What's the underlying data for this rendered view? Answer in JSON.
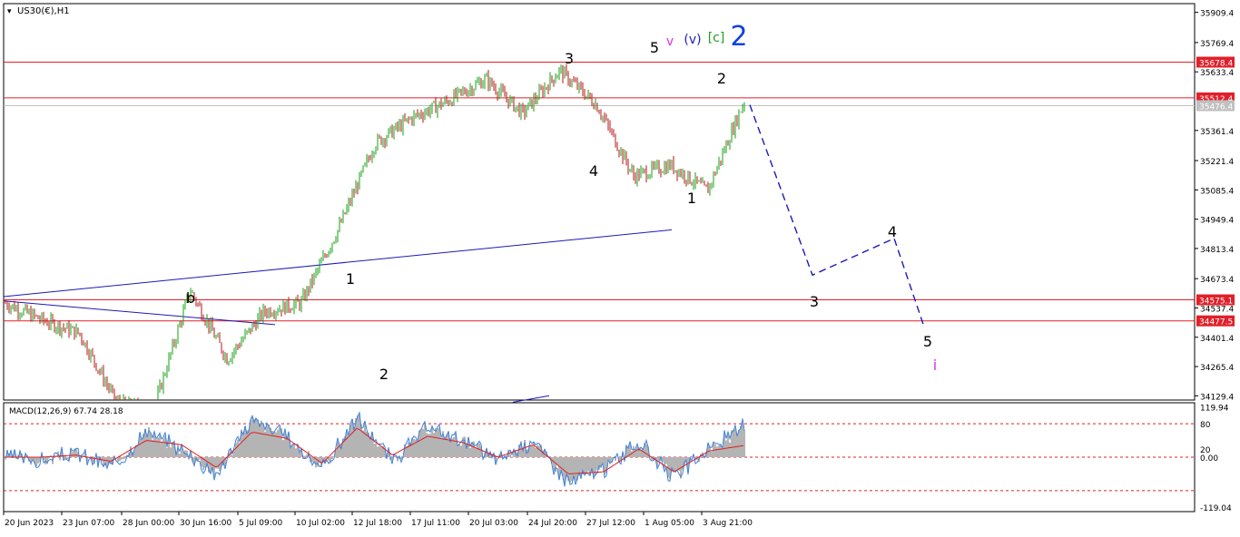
{
  "chart_data": [
    {
      "type": "candlestick",
      "title": "US30(€),H1",
      "y_ticks": [
        35909.4,
        35769.4,
        35633.4,
        35361.4,
        35221.4,
        35085.4,
        34949.4,
        34813.4,
        34673.4,
        34537.4,
        34401.4,
        34265.4,
        34129.4
      ],
      "ylim": [
        34110,
        35950
      ],
      "price_levels": [
        {
          "label": "35678.4",
          "color": "#e0202a"
        },
        {
          "label": "35512.4",
          "color": "#e0202a"
        },
        {
          "label": "35476.4",
          "color": "#c0c0c0"
        },
        {
          "label": "34575.1",
          "color": "#e0202a"
        },
        {
          "label": "34477.5",
          "color": "#e0202a"
        }
      ],
      "wave_labels": [
        {
          "text": "b",
          "color": "#000000",
          "value": 34620,
          "date_index": 3
        },
        {
          "text": "1",
          "color": "#000000",
          "value": 34700,
          "date_index": 6
        },
        {
          "text": "2",
          "color": "#000000",
          "value": 34230,
          "date_index": 6
        },
        {
          "text": "3",
          "color": "#000000",
          "value": 35640,
          "date_index": 10
        },
        {
          "text": "4",
          "color": "#000000",
          "value": 35190,
          "date_index": 10
        },
        {
          "text": "5",
          "color": "#000000",
          "value": 35720,
          "date_index": 11
        },
        {
          "text": "v",
          "color": "#e030e0",
          "value": 35740,
          "date_index": 11
        },
        {
          "text": "(v)",
          "color": "#2020c0",
          "value": 35740,
          "date_index": 11
        },
        {
          "text": "[c]",
          "color": "#20a020",
          "value": 35740,
          "date_index": 12
        },
        {
          "text": "2",
          "color": "#1040e0",
          "value": 35740,
          "date_index": 12
        },
        {
          "text": "1",
          "color": "#000000",
          "value": 35050,
          "date_index": 12
        },
        {
          "text": "2",
          "color": "#000000",
          "value": 35580,
          "date_index": 12
        },
        {
          "text": "3",
          "color": "#000000",
          "value": 34550,
          "date_index": 14
        },
        {
          "text": "4",
          "color": "#000000",
          "value": 34880,
          "date_index": 15
        },
        {
          "text": "5",
          "color": "#000000",
          "value": 34400,
          "date_index": 16
        },
        {
          "text": "i",
          "color": "#e030e0",
          "value": 34300,
          "date_index": 16
        }
      ],
      "projection": {
        "style": "dashed",
        "color": "#1a1ab8",
        "points": [
          {
            "date_index": 13,
            "value": 35480
          },
          {
            "date_index": 14,
            "value": 34690
          },
          {
            "date_index": 15,
            "value": 34860
          },
          {
            "date_index": 16,
            "value": 34450
          }
        ]
      },
      "x_ticks": [
        "20 Jun 2023",
        "23 Jun 07:00",
        "28 Jun 00:00",
        "30 Jun 16:00",
        "5 Jul 09:00",
        "10 Jul 02:00",
        "12 Jul 18:00",
        "17 Jul 11:00",
        "20 Jul 03:00",
        "24 Jul 20:00",
        "27 Jul 12:00",
        "1 Aug 05:00",
        "3 Aug 21:00"
      ],
      "series": [
        {
          "role": "price",
          "values": [
            34560,
            34480,
            34420,
            34100,
            34060,
            34620,
            34300,
            34520,
            34560,
            34900,
            35300,
            35420,
            35500,
            35600,
            35440,
            35640,
            35480,
            35150,
            35200,
            35080,
            35500
          ]
        }
      ],
      "line_colors": {
        "up": "#16a016",
        "down": "#b41414"
      }
    },
    {
      "type": "line",
      "title": "MACD(12,26,9) 67.74 28.18",
      "y_ticks": [
        119.94,
        80,
        0,
        20,
        -119.04
      ],
      "y_tick_labels": [
        "119.94",
        "80",
        "0.00",
        "20",
        "-119.04"
      ],
      "ylim": [
        -130,
        130
      ],
      "levels": [
        80,
        0,
        -80
      ],
      "series": [
        {
          "role": "histogram",
          "color": "#b4b4b4",
          "values": [
            5,
            -10,
            10,
            -25,
            60,
            20,
            -40,
            90,
            50,
            -30,
            95,
            -10,
            70,
            40,
            -5,
            40,
            -60,
            -30,
            35,
            -50,
            20,
            70
          ]
        },
        {
          "role": "signal",
          "color": "#e02020",
          "values": [
            0,
            0,
            5,
            -10,
            40,
            30,
            -25,
            60,
            45,
            -15,
            70,
            5,
            50,
            35,
            0,
            30,
            -40,
            -35,
            20,
            -35,
            15,
            28
          ]
        }
      ]
    }
  ]
}
